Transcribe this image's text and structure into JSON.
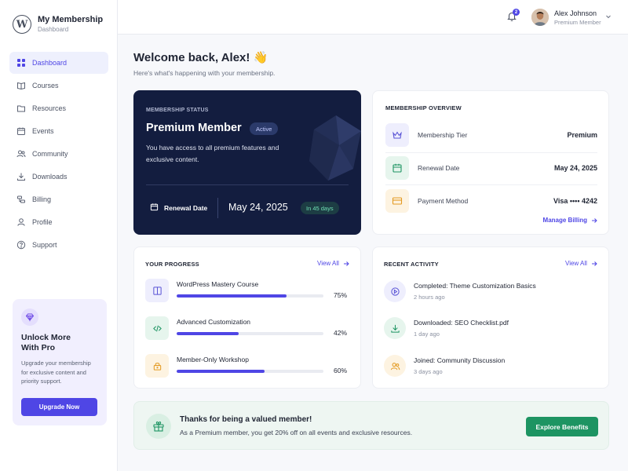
{
  "brand": {
    "title": "My Membership",
    "subtitle": "Dashboard"
  },
  "nav": {
    "items": [
      {
        "label": "Dashboard",
        "icon": "grid-icon",
        "active": true
      },
      {
        "label": "Courses",
        "icon": "book-icon"
      },
      {
        "label": "Resources",
        "icon": "folder-icon"
      },
      {
        "label": "Events",
        "icon": "calendar-icon"
      },
      {
        "label": "Community",
        "icon": "users-icon"
      },
      {
        "label": "Downloads",
        "icon": "download-icon"
      },
      {
        "label": "Billing",
        "icon": "billing-icon"
      },
      {
        "label": "Profile",
        "icon": "user-icon"
      },
      {
        "label": "Support",
        "icon": "help-icon"
      }
    ]
  },
  "promo": {
    "title": "Unlock More With Pro",
    "text": "Upgrade your membership for exclusive content and priority support.",
    "button": "Upgrade Now"
  },
  "topbar": {
    "notification_count": "2",
    "user_name": "Alex Johnson",
    "user_role": "Premium Member"
  },
  "welcome": {
    "title": "Welcome back, Alex! 👋",
    "subtitle": "Here's what's happening with your membership."
  },
  "status": {
    "label": "MEMBERSHIP STATUS",
    "title": "Premium Member",
    "badge": "Active",
    "description": "You have access to all premium features and exclusive content.",
    "renewal_label": "Renewal Date",
    "renewal_date": "May 24, 2025",
    "days_left": "In 45 days"
  },
  "overview": {
    "title": "MEMBERSHIP OVERVIEW",
    "rows": [
      {
        "label": "Membership Tier",
        "value": "Premium",
        "icon": "crown-icon"
      },
      {
        "label": "Renewal Date",
        "value": "May 24, 2025",
        "icon": "calendar-icon"
      },
      {
        "label": "Payment Method",
        "value": "Visa •••• 4242",
        "icon": "card-icon"
      }
    ],
    "manage_link": "Manage Billing"
  },
  "progress": {
    "title": "YOUR PROGRESS",
    "view_all": "View All",
    "items": [
      {
        "name": "WordPress Mastery Course",
        "percent_label": "75%",
        "percent": 75
      },
      {
        "name": "Advanced Customization",
        "percent_label": "42%",
        "percent": 42
      },
      {
        "name": "Member-Only Workshop",
        "percent_label": "60%",
        "percent": 60
      }
    ]
  },
  "activity": {
    "title": "RECENT ACTIVITY",
    "view_all": "View All",
    "items": [
      {
        "title": "Completed: Theme Customization Basics",
        "time": "2 hours ago",
        "icon": "play-icon"
      },
      {
        "title": "Downloaded: SEO Checklist.pdf",
        "time": "1 day ago",
        "icon": "download-icon"
      },
      {
        "title": "Joined: Community Discussion",
        "time": "3 days ago",
        "icon": "users-icon"
      }
    ]
  },
  "thanks": {
    "title": "Thanks for being a valued member!",
    "text": "As a Premium member, you get 20% off on all events and exclusive resources.",
    "button": "Explore Benefits"
  },
  "colors": {
    "accent": "#4f46e5",
    "status_card": "#131d3f",
    "success": "#1d9462"
  }
}
